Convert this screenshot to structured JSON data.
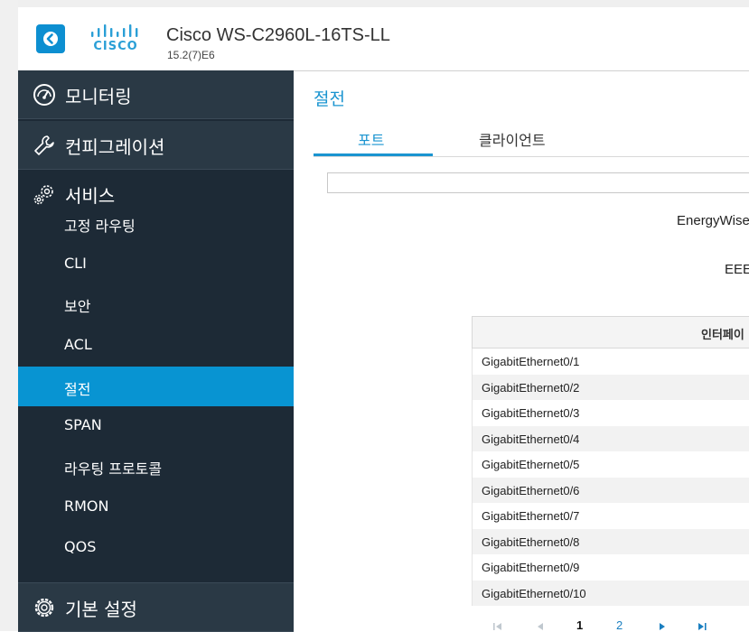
{
  "header": {
    "logo_text": "CISCO",
    "device_title": "Cisco WS-C2960L-16TS-LL",
    "device_version": "15.2(7)E6"
  },
  "sidebar": {
    "sections": [
      {
        "label": "모니터링",
        "icon": "dashboard-gauge-icon"
      },
      {
        "label": "컨피그레이션",
        "icon": "wrench-icon"
      },
      {
        "label": "서비스",
        "icon": "gears-icon"
      },
      {
        "label": "기본 설정",
        "icon": "gear-icon"
      }
    ],
    "service_items": [
      {
        "label": "고정 라우팅"
      },
      {
        "label": "CLI"
      },
      {
        "label": "보안"
      },
      {
        "label": "ACL"
      },
      {
        "label": "절전",
        "active": true
      },
      {
        "label": "SPAN"
      },
      {
        "label": "라우팅 프로토콜"
      },
      {
        "label": "RMON"
      },
      {
        "label": "QOS"
      }
    ]
  },
  "main": {
    "page_title": "절전",
    "tabs": [
      {
        "label": "포트",
        "active": true
      },
      {
        "label": "클라이언트",
        "active": false
      }
    ],
    "filter_value": "",
    "energywise_label": "EnergyWise",
    "eee_label": "EEE",
    "table": {
      "header": "인터페이",
      "rows": [
        "GigabitEthernet0/1",
        "GigabitEthernet0/2",
        "GigabitEthernet0/3",
        "GigabitEthernet0/4",
        "GigabitEthernet0/5",
        "GigabitEthernet0/6",
        "GigabitEthernet0/7",
        "GigabitEthernet0/8",
        "GigabitEthernet0/9",
        "GigabitEthernet0/10"
      ]
    },
    "pagination": {
      "pages": [
        "1",
        "2"
      ],
      "current": "1"
    }
  },
  "colors": {
    "accent": "#1a94d0",
    "sidebar_bg": "#1d2a36",
    "sidebar_section_bg": "#2a3945",
    "active_item": "#0894d2"
  }
}
